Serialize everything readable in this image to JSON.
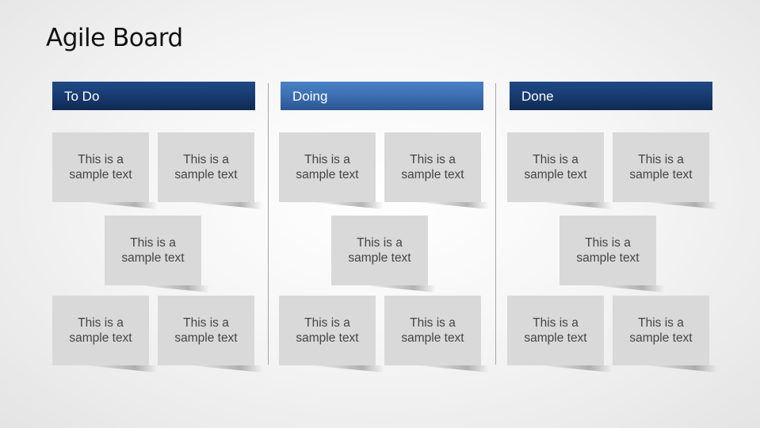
{
  "slide": {
    "title": "Agile Board"
  },
  "columns": [
    {
      "id": "todo",
      "header": "To Do",
      "header_color": "#173a6e",
      "cards": [
        {
          "line1": "This is a",
          "line2": "sample text"
        },
        {
          "line1": "This is a",
          "line2": "sample text"
        },
        {
          "line1": "This is a",
          "line2": "sample text"
        },
        {
          "line1": "This is a",
          "line2": "sample text"
        },
        {
          "line1": "This is a",
          "line2": "sample text"
        }
      ]
    },
    {
      "id": "doing",
      "header": "Doing",
      "header_color": "#3b6fb1",
      "cards": [
        {
          "line1": "This is a",
          "line2": "sample text"
        },
        {
          "line1": "This is a",
          "line2": "sample text"
        },
        {
          "line1": "This is a",
          "line2": "sample text"
        },
        {
          "line1": "This is a",
          "line2": "sample text"
        },
        {
          "line1": "This is a",
          "line2": "sample text"
        }
      ]
    },
    {
      "id": "done",
      "header": "Done",
      "header_color": "#173a6e",
      "cards": [
        {
          "line1": "This is a",
          "line2": "sample text"
        },
        {
          "line1": "This is a",
          "line2": "sample text"
        },
        {
          "line1": "This is a",
          "line2": "sample text"
        },
        {
          "line1": "This is a",
          "line2": "sample text"
        },
        {
          "line1": "This is a",
          "line2": "sample text"
        }
      ]
    }
  ],
  "colors": {
    "card_bg": "#d9d9d9",
    "card_text": "#444444",
    "divider": "#a6a6a6"
  }
}
